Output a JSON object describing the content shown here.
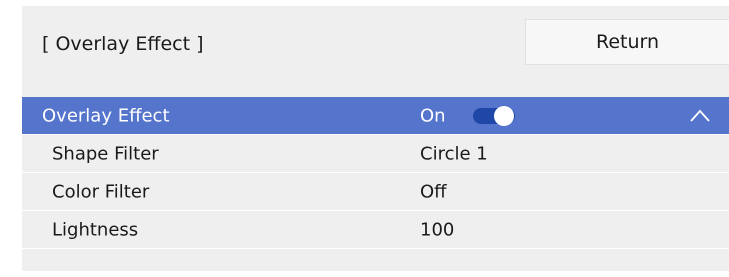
{
  "header": {
    "title": "[ Overlay Effect ]",
    "return_label": "Return"
  },
  "menu": {
    "items": [
      {
        "label": "Overlay Effect",
        "value": "On",
        "toggle_state": "on",
        "expanded": true
      },
      {
        "label": "Shape Filter",
        "value": "Circle 1"
      },
      {
        "label": "Color Filter",
        "value": "Off"
      },
      {
        "label": "Lightness",
        "value": "100"
      }
    ]
  },
  "colors": {
    "selected_row": "#5574cc",
    "toggle_track": "#1f47a8",
    "panel_background": "#efeff0"
  },
  "icons": {
    "collapse": "chevron-up-icon"
  }
}
